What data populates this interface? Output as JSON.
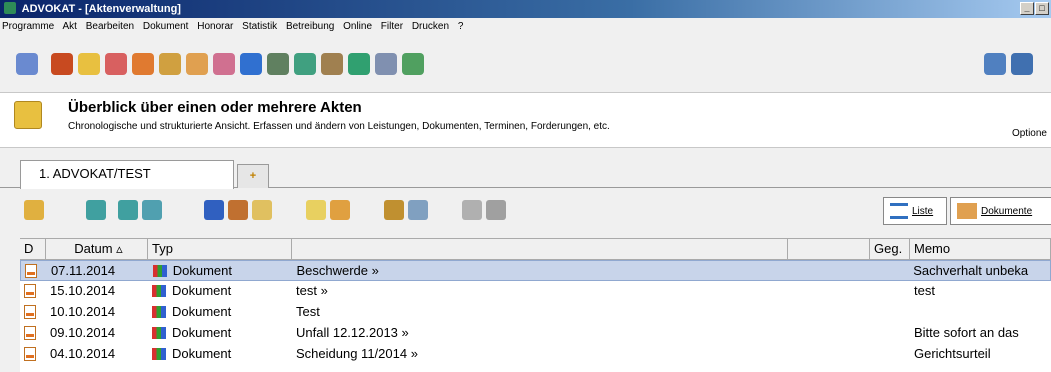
{
  "window": {
    "title": "ADVOKAT - [Aktenverwaltung]"
  },
  "menu": [
    "Programme",
    "Akt",
    "Bearbeiten",
    "Dokument",
    "Honorar",
    "Statistik",
    "Betreibung",
    "Online",
    "Filter",
    "Drucken",
    "?"
  ],
  "toolbar_icons": [
    "search-icon",
    "contacts-icon",
    "folder-icon",
    "calendar-icon",
    "person-icon",
    "cd-icon",
    "book-icon",
    "diary-icon",
    "chart-icon",
    "table-icon",
    "graph-icon",
    "bank-icon",
    "refresh-icon",
    "form-icon",
    "app-icon"
  ],
  "header": {
    "title": "Überblick über einen oder mehrere Akten",
    "subtitle": "Chronologische und strukturierte Ansicht. Erfassen und ändern von Leistungen, Dokumenten, Terminen, Forderungen, etc.",
    "options": "Optione"
  },
  "tabs": {
    "active": "1. ADVOKAT/TEST",
    "add": "+"
  },
  "views": {
    "list": "Liste",
    "docs": "Dokumente"
  },
  "grid": {
    "headers": [
      "D",
      "Datum ▵",
      "Typ",
      "",
      "",
      "Geg.",
      "Memo"
    ],
    "rows": [
      {
        "date": "07.11.2014",
        "type": "Dokument",
        "title": "Beschwerde  »",
        "memo": "Sachverhalt unbeka"
      },
      {
        "date": "15.10.2014",
        "type": "Dokument",
        "title": "test  »",
        "memo": "test"
      },
      {
        "date": "10.10.2014",
        "type": "Dokument",
        "title": "Test",
        "memo": ""
      },
      {
        "date": "09.10.2014",
        "type": "Dokument",
        "title": "Unfall 12.12.2013  »",
        "memo": "Bitte sofort an das"
      },
      {
        "date": "04.10.2014",
        "type": "Dokument",
        "title": "Scheidung 11/2014  »",
        "memo": "Gerichtsurteil"
      }
    ]
  }
}
